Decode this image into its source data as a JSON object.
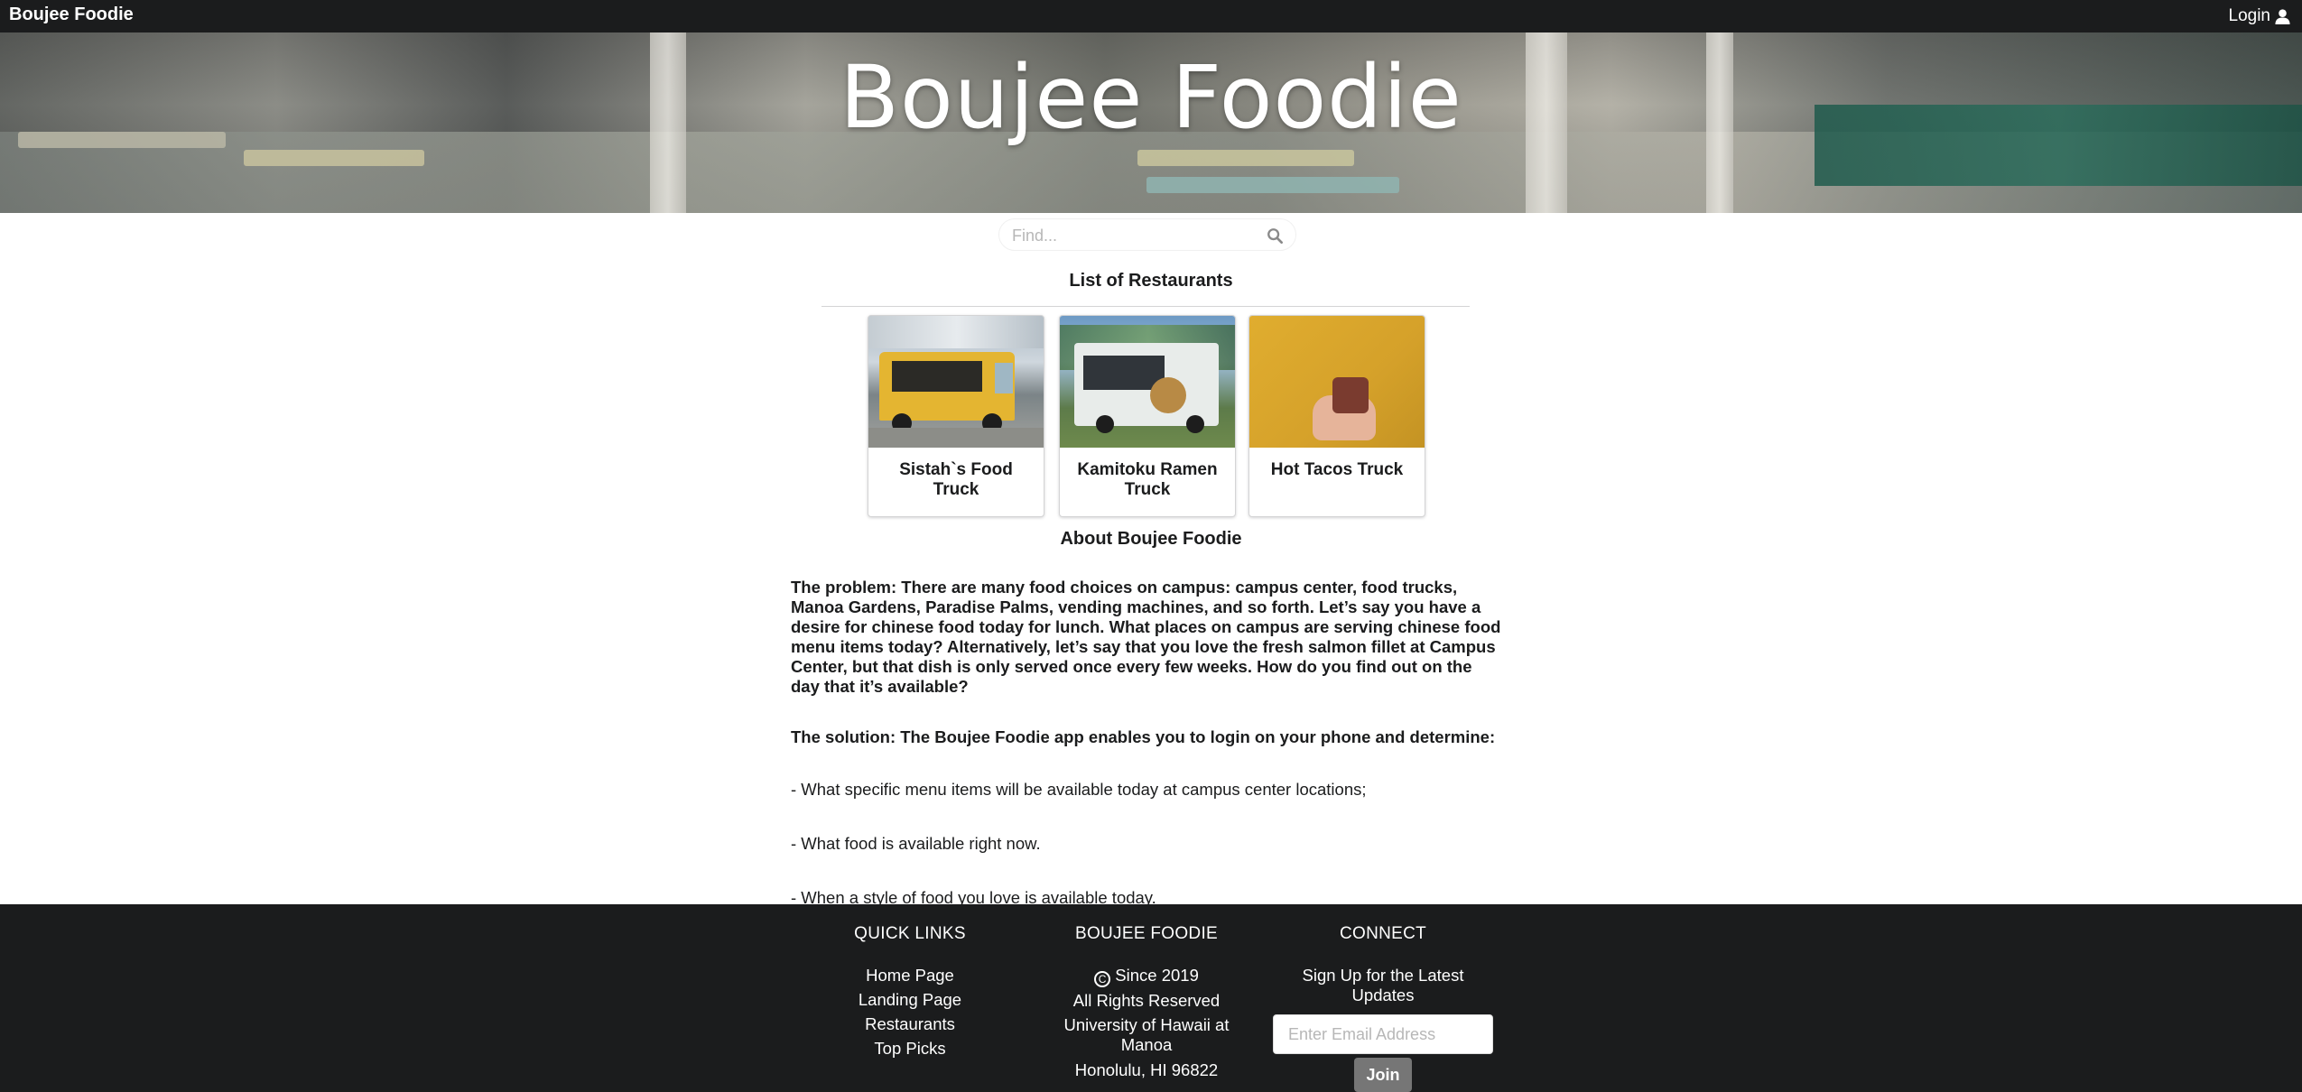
{
  "topbar": {
    "brand": "Boujee Foodie",
    "login_label": "Login",
    "login_icon": "user-icon"
  },
  "hero": {
    "title": "Boujee Foodie"
  },
  "search": {
    "placeholder": "Find...",
    "icon": "search-icon"
  },
  "restaurants": {
    "heading": "List of Restaurants",
    "items": [
      {
        "name": "Sistah`s Food Truck"
      },
      {
        "name": "Kamitoku Ramen Truck"
      },
      {
        "name": "Hot Tacos Truck"
      }
    ]
  },
  "about": {
    "heading": "About Boujee Foodie",
    "problem": "The problem: There are many food choices on campus: campus center, food trucks, Manoa Gardens, Paradise Palms, vending machines, and so forth. Let’s say you have a desire for chinese food today for lunch. What places on campus are serving chinese food menu items today? Alternatively, let’s say that you love the fresh salmon fillet at Campus Center, but that dish is only served once every few weeks. How do you find out on the day that it’s available?",
    "solution": "The solution: The Boujee Foodie app enables you to login on your phone and determine:",
    "bullets": [
      "- What specific menu items will be available today at campus center locations;",
      "- What food is available right now.",
      "- When a style of food you love is available today."
    ]
  },
  "footer": {
    "quick_links": {
      "heading": "QUICK LINKS",
      "links": [
        "Home Page",
        "Landing Page",
        "Restaurants",
        "Top Picks"
      ]
    },
    "about": {
      "heading": "BOUJEE FOODIE",
      "since": "Since 2019",
      "copyright_icon": "copyright-icon",
      "rights": "All Rights Reserved",
      "university": "University of Hawaii at Manoa",
      "address": "Honolulu, HI 96822"
    },
    "connect": {
      "heading": "CONNECT",
      "signup_text": "Sign Up for the Latest Updates",
      "email_placeholder": "Enter Email Address",
      "join_label": "Join"
    }
  },
  "colors": {
    "menu_bg": "#1b1c1d",
    "footer_bg": "#1b1c1d",
    "join_button": "#767676"
  }
}
